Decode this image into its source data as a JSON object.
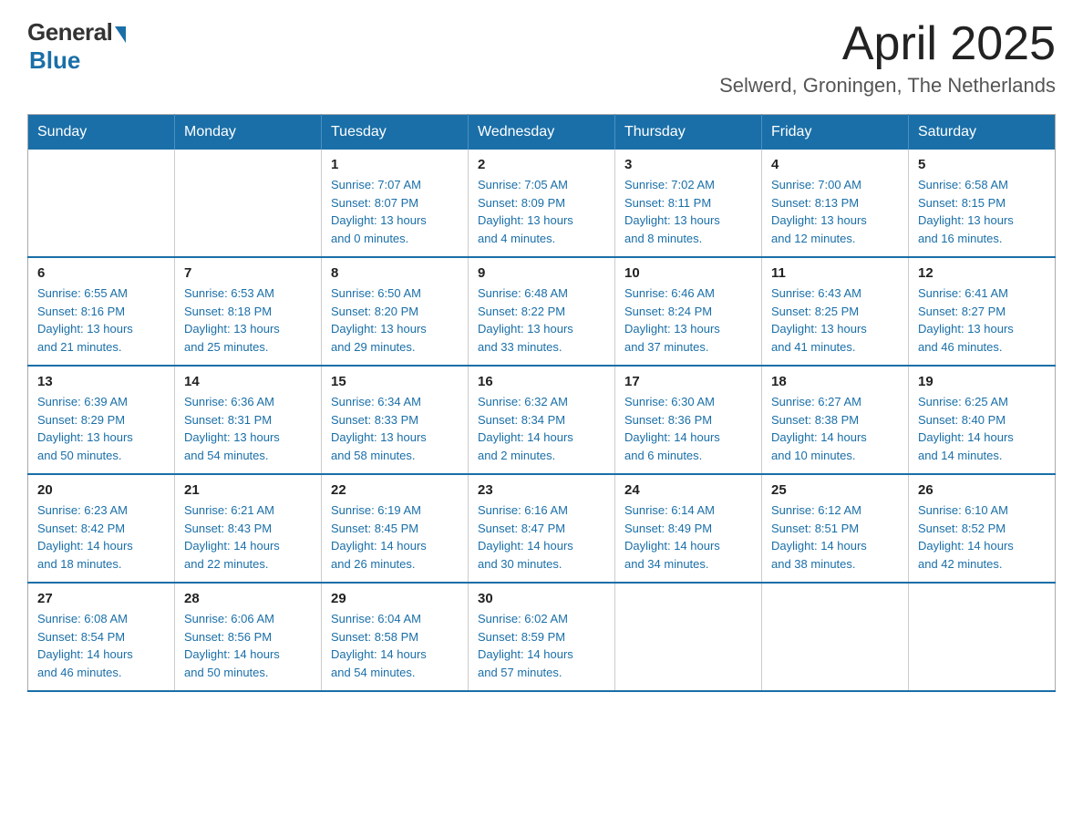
{
  "logo": {
    "general_text": "General",
    "blue_text": "Blue"
  },
  "title": {
    "month_year": "April 2025",
    "location": "Selwerd, Groningen, The Netherlands"
  },
  "weekdays": [
    "Sunday",
    "Monday",
    "Tuesday",
    "Wednesday",
    "Thursday",
    "Friday",
    "Saturday"
  ],
  "weeks": [
    [
      {
        "day": "",
        "info": ""
      },
      {
        "day": "",
        "info": ""
      },
      {
        "day": "1",
        "info": "Sunrise: 7:07 AM\nSunset: 8:07 PM\nDaylight: 13 hours\nand 0 minutes."
      },
      {
        "day": "2",
        "info": "Sunrise: 7:05 AM\nSunset: 8:09 PM\nDaylight: 13 hours\nand 4 minutes."
      },
      {
        "day": "3",
        "info": "Sunrise: 7:02 AM\nSunset: 8:11 PM\nDaylight: 13 hours\nand 8 minutes."
      },
      {
        "day": "4",
        "info": "Sunrise: 7:00 AM\nSunset: 8:13 PM\nDaylight: 13 hours\nand 12 minutes."
      },
      {
        "day": "5",
        "info": "Sunrise: 6:58 AM\nSunset: 8:15 PM\nDaylight: 13 hours\nand 16 minutes."
      }
    ],
    [
      {
        "day": "6",
        "info": "Sunrise: 6:55 AM\nSunset: 8:16 PM\nDaylight: 13 hours\nand 21 minutes."
      },
      {
        "day": "7",
        "info": "Sunrise: 6:53 AM\nSunset: 8:18 PM\nDaylight: 13 hours\nand 25 minutes."
      },
      {
        "day": "8",
        "info": "Sunrise: 6:50 AM\nSunset: 8:20 PM\nDaylight: 13 hours\nand 29 minutes."
      },
      {
        "day": "9",
        "info": "Sunrise: 6:48 AM\nSunset: 8:22 PM\nDaylight: 13 hours\nand 33 minutes."
      },
      {
        "day": "10",
        "info": "Sunrise: 6:46 AM\nSunset: 8:24 PM\nDaylight: 13 hours\nand 37 minutes."
      },
      {
        "day": "11",
        "info": "Sunrise: 6:43 AM\nSunset: 8:25 PM\nDaylight: 13 hours\nand 41 minutes."
      },
      {
        "day": "12",
        "info": "Sunrise: 6:41 AM\nSunset: 8:27 PM\nDaylight: 13 hours\nand 46 minutes."
      }
    ],
    [
      {
        "day": "13",
        "info": "Sunrise: 6:39 AM\nSunset: 8:29 PM\nDaylight: 13 hours\nand 50 minutes."
      },
      {
        "day": "14",
        "info": "Sunrise: 6:36 AM\nSunset: 8:31 PM\nDaylight: 13 hours\nand 54 minutes."
      },
      {
        "day": "15",
        "info": "Sunrise: 6:34 AM\nSunset: 8:33 PM\nDaylight: 13 hours\nand 58 minutes."
      },
      {
        "day": "16",
        "info": "Sunrise: 6:32 AM\nSunset: 8:34 PM\nDaylight: 14 hours\nand 2 minutes."
      },
      {
        "day": "17",
        "info": "Sunrise: 6:30 AM\nSunset: 8:36 PM\nDaylight: 14 hours\nand 6 minutes."
      },
      {
        "day": "18",
        "info": "Sunrise: 6:27 AM\nSunset: 8:38 PM\nDaylight: 14 hours\nand 10 minutes."
      },
      {
        "day": "19",
        "info": "Sunrise: 6:25 AM\nSunset: 8:40 PM\nDaylight: 14 hours\nand 14 minutes."
      }
    ],
    [
      {
        "day": "20",
        "info": "Sunrise: 6:23 AM\nSunset: 8:42 PM\nDaylight: 14 hours\nand 18 minutes."
      },
      {
        "day": "21",
        "info": "Sunrise: 6:21 AM\nSunset: 8:43 PM\nDaylight: 14 hours\nand 22 minutes."
      },
      {
        "day": "22",
        "info": "Sunrise: 6:19 AM\nSunset: 8:45 PM\nDaylight: 14 hours\nand 26 minutes."
      },
      {
        "day": "23",
        "info": "Sunrise: 6:16 AM\nSunset: 8:47 PM\nDaylight: 14 hours\nand 30 minutes."
      },
      {
        "day": "24",
        "info": "Sunrise: 6:14 AM\nSunset: 8:49 PM\nDaylight: 14 hours\nand 34 minutes."
      },
      {
        "day": "25",
        "info": "Sunrise: 6:12 AM\nSunset: 8:51 PM\nDaylight: 14 hours\nand 38 minutes."
      },
      {
        "day": "26",
        "info": "Sunrise: 6:10 AM\nSunset: 8:52 PM\nDaylight: 14 hours\nand 42 minutes."
      }
    ],
    [
      {
        "day": "27",
        "info": "Sunrise: 6:08 AM\nSunset: 8:54 PM\nDaylight: 14 hours\nand 46 minutes."
      },
      {
        "day": "28",
        "info": "Sunrise: 6:06 AM\nSunset: 8:56 PM\nDaylight: 14 hours\nand 50 minutes."
      },
      {
        "day": "29",
        "info": "Sunrise: 6:04 AM\nSunset: 8:58 PM\nDaylight: 14 hours\nand 54 minutes."
      },
      {
        "day": "30",
        "info": "Sunrise: 6:02 AM\nSunset: 8:59 PM\nDaylight: 14 hours\nand 57 minutes."
      },
      {
        "day": "",
        "info": ""
      },
      {
        "day": "",
        "info": ""
      },
      {
        "day": "",
        "info": ""
      }
    ]
  ]
}
